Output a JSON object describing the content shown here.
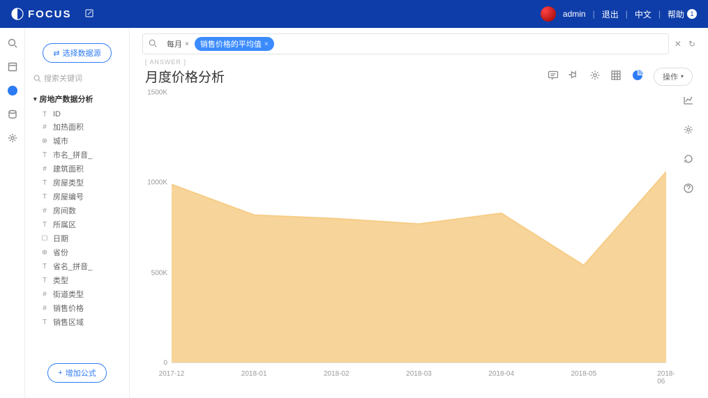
{
  "header": {
    "brand": "FOCUS",
    "user": "admin",
    "logout": "退出",
    "lang": "中文",
    "help": "帮助",
    "help_count": "1"
  },
  "sidebar": {
    "select_source_btn": "选择数据源",
    "search_placeholder": "搜索关键词",
    "tree_root": "房地产数据分析",
    "fields": [
      {
        "icon": "T",
        "label": "ID"
      },
      {
        "icon": "#",
        "label": "加热面积"
      },
      {
        "icon": "⊕",
        "label": "城市"
      },
      {
        "icon": "T",
        "label": "市名_拼音_"
      },
      {
        "icon": "#",
        "label": "建筑面积"
      },
      {
        "icon": "T",
        "label": "房屋类型"
      },
      {
        "icon": "T",
        "label": "房屋编号"
      },
      {
        "icon": "#",
        "label": "房间数"
      },
      {
        "icon": "T",
        "label": "所属区"
      },
      {
        "icon": "☐",
        "label": "日期"
      },
      {
        "icon": "⊕",
        "label": "省份"
      },
      {
        "icon": "T",
        "label": "省名_拼音_"
      },
      {
        "icon": "T",
        "label": "类型"
      },
      {
        "icon": "#",
        "label": "街道类型"
      },
      {
        "icon": "#",
        "label": "销售价格"
      },
      {
        "icon": "T",
        "label": "销售区域"
      }
    ],
    "add_formula_btn": "增加公式"
  },
  "query": {
    "chips": [
      {
        "label": "每月",
        "style": "plain"
      },
      {
        "label": "销售价格的平均值",
        "style": "blue"
      }
    ]
  },
  "answer": {
    "section_label": "[ ANSWER ]",
    "title": "月度价格分析",
    "op_button": "操作"
  },
  "chart_data": {
    "type": "area",
    "title": "月度价格分析",
    "xlabel": "",
    "ylabel": "",
    "ylim": [
      0,
      1500000
    ],
    "y_ticks": [
      "0",
      "500K",
      "1000K",
      "1500K"
    ],
    "categories": [
      "2017-12",
      "2018-01",
      "2018-02",
      "2018-03",
      "2018-04",
      "2018-05",
      "2018-06"
    ],
    "values": [
      990000,
      820000,
      800000,
      770000,
      830000,
      540000,
      1060000
    ],
    "color": "#f6cd87"
  }
}
